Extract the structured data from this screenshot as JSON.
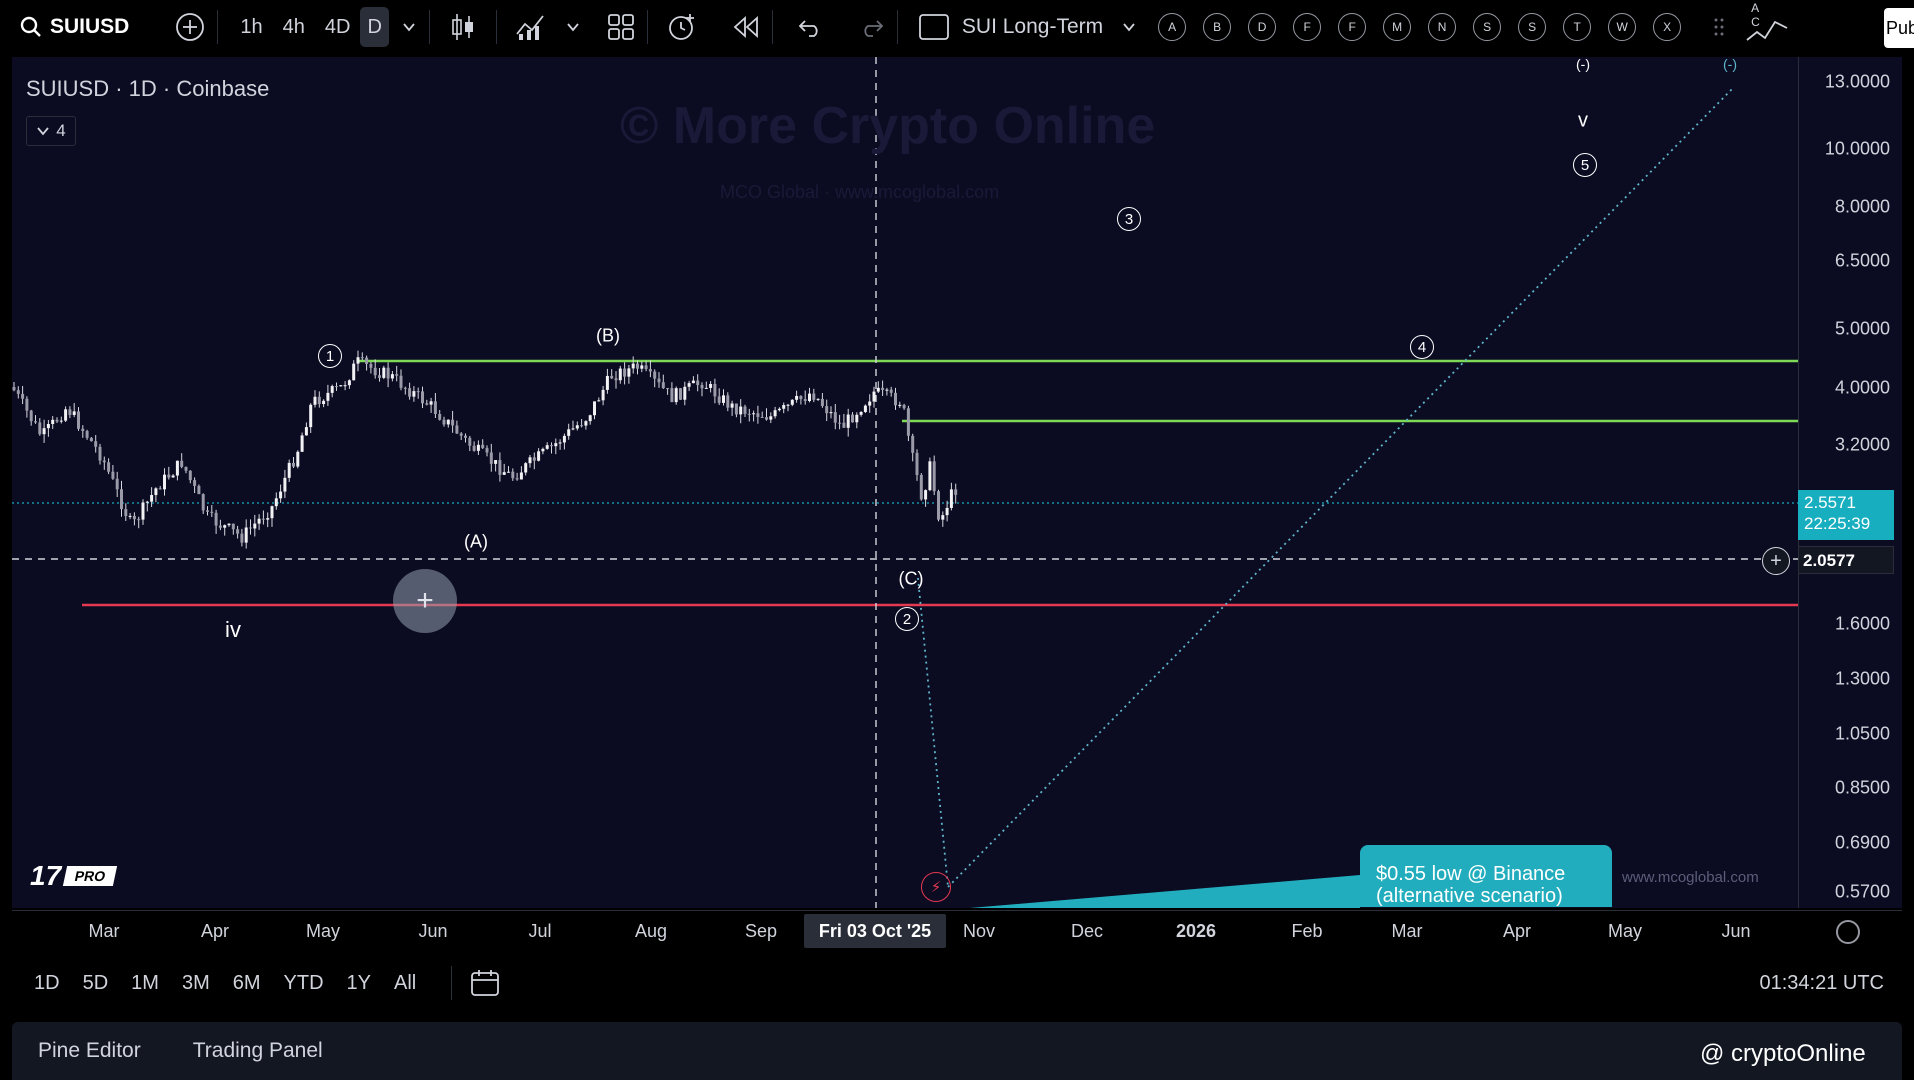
{
  "toolbar": {
    "symbol": "SUIUSD",
    "intervals": [
      "1h",
      "4h",
      "4D",
      "D"
    ],
    "active_interval": "D",
    "layout_name": "SUI Long-Term",
    "alert_letters": [
      "A",
      "B",
      "D",
      "F",
      "F",
      "M",
      "N",
      "S",
      "S",
      "T",
      "W",
      "X"
    ],
    "publish_label": "Pub",
    "top_right_letters": "A C"
  },
  "chart": {
    "title": "SUIUSD · 1D · Coinbase",
    "indicator_count": "4",
    "watermark": "© More Crypto Online",
    "watermark_sub": "MCO Global · www.mcoglobal.com",
    "site_mark": "www.mcoglobal.com",
    "logo_pro": "PRO",
    "logo_tv": "17",
    "last_price": "2.5571",
    "countdown": "22:25:39",
    "crosshair_price": "2.0577",
    "callout_line1": "$0.55 low @ Binance",
    "callout_line2": "(alternative scenario)",
    "crosshair_date": "Fri 03 Oct '25",
    "colors": {
      "support_green": "#7ed957",
      "support_red": "#e53950",
      "wave_path": "#5fb6c9",
      "last_price_tag": "#17aebf"
    }
  },
  "waves": {
    "w1": "1",
    "wB": "(B)",
    "wA": "(A)",
    "wC": "(C)",
    "w2": "2",
    "w3": "3",
    "w4": "4",
    "w5": "5",
    "wv": "v",
    "wiv": "iv",
    "wtop1": "(-)",
    "wtop2": "(-)"
  },
  "price_scale": [
    "13.0000",
    "10.0000",
    "8.0000",
    "6.5000",
    "5.0000",
    "4.0000",
    "3.2000",
    "1.6000",
    "1.3000",
    "1.0500",
    "0.8500",
    "0.6900",
    "0.5700"
  ],
  "time_axis": [
    "Mar",
    "Apr",
    "May",
    "Jun",
    "Jul",
    "Aug",
    "Sep",
    "Nov",
    "Dec",
    "2026",
    "Feb",
    "Mar",
    "Apr",
    "May",
    "Jun"
  ],
  "range_bar": {
    "ranges": [
      "1D",
      "5D",
      "1M",
      "3M",
      "6M",
      "YTD",
      "1Y",
      "All"
    ],
    "clock": "01:34:21 UTC"
  },
  "bottom_panel": {
    "tabs": [
      "Pine Editor",
      "Trading Panel"
    ],
    "channel": "@ cryptoOnline"
  }
}
